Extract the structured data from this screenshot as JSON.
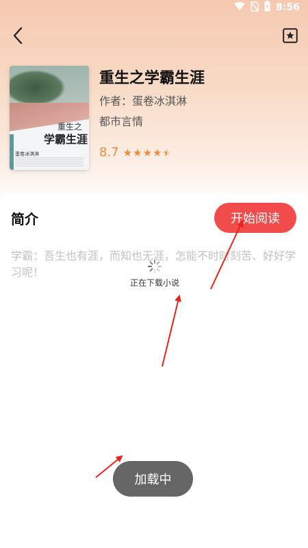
{
  "status_bar": {
    "time": "8:56"
  },
  "icons": {
    "back": "back-arrow-icon",
    "favorite": "bookmark-star-icon",
    "wifi": "wifi-icon",
    "sim": "no-sim-icon",
    "battery": "battery-charging-icon",
    "spinner": "loading-spinner-icon"
  },
  "book": {
    "title": "重生之学霸生涯",
    "author": "作者：蛋卷冰淇淋",
    "genre": "都市言情",
    "rating": "8.7",
    "rating_stars": 4.5,
    "cover": {
      "title_line1": "重生之",
      "title_line2": "学霸生涯",
      "author": "蛋卷冰淇淋"
    }
  },
  "intro": {
    "heading": "简介",
    "text": "学霸：吾生也有涯，而知也无涯，怎能不时时刻苦、好好学习呢！"
  },
  "actions": {
    "start_reading": "开始阅读"
  },
  "loading": {
    "text": "正在下载小说"
  },
  "toast": {
    "text": "加载中"
  },
  "colors": {
    "accent": "#f24b4b",
    "rating": "#f08a3c",
    "toast_bg": "#666666",
    "annotation_arrow": "#e8231d"
  }
}
